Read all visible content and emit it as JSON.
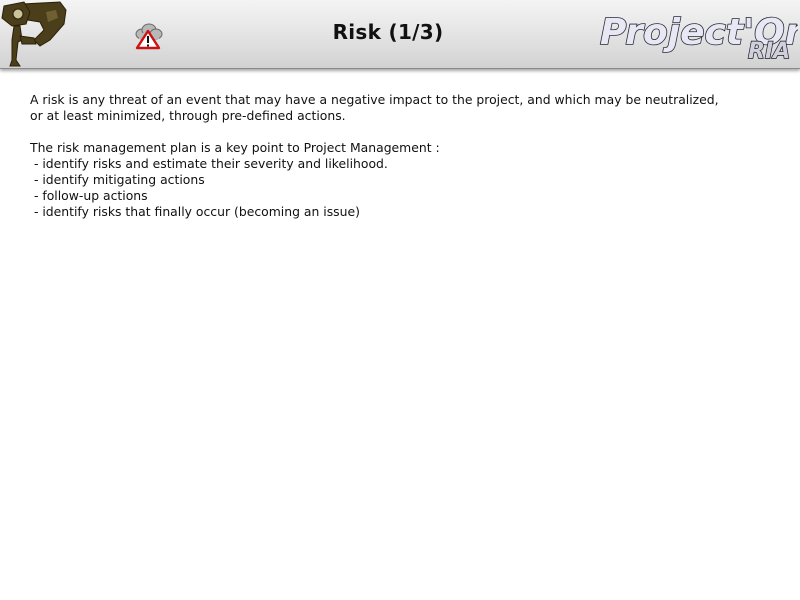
{
  "header": {
    "title": "Risk (1/3)",
    "logo_main": "Project'Or",
    "logo_badge": "RIA",
    "camera_icon": "security-camera-icon",
    "risk_icon": "cloud-warning-icon"
  },
  "content": {
    "definition_line1": "A risk is any threat of an event that may have a negative impact to the project, and which may be neutralized,",
    "definition_line2": "or at least minimized, through pre-defined actions.",
    "plan_intro": "The risk management plan is a key point to Project Management :",
    "plan_items": [
      " - identify risks and estimate their severity and likelihood.",
      " - identify mitigating actions",
      " - follow-up actions",
      " - identify risks that finally occur (becoming an issue)"
    ]
  },
  "colors": {
    "header_gradient_top": "#f4f4f4",
    "header_gradient_bottom": "#d2d2d2",
    "camera_olive": "#4a3f1a",
    "warning_red": "#cc1111",
    "logo_fill": "#e8e8f4",
    "logo_outline": "#2a2a3a"
  }
}
